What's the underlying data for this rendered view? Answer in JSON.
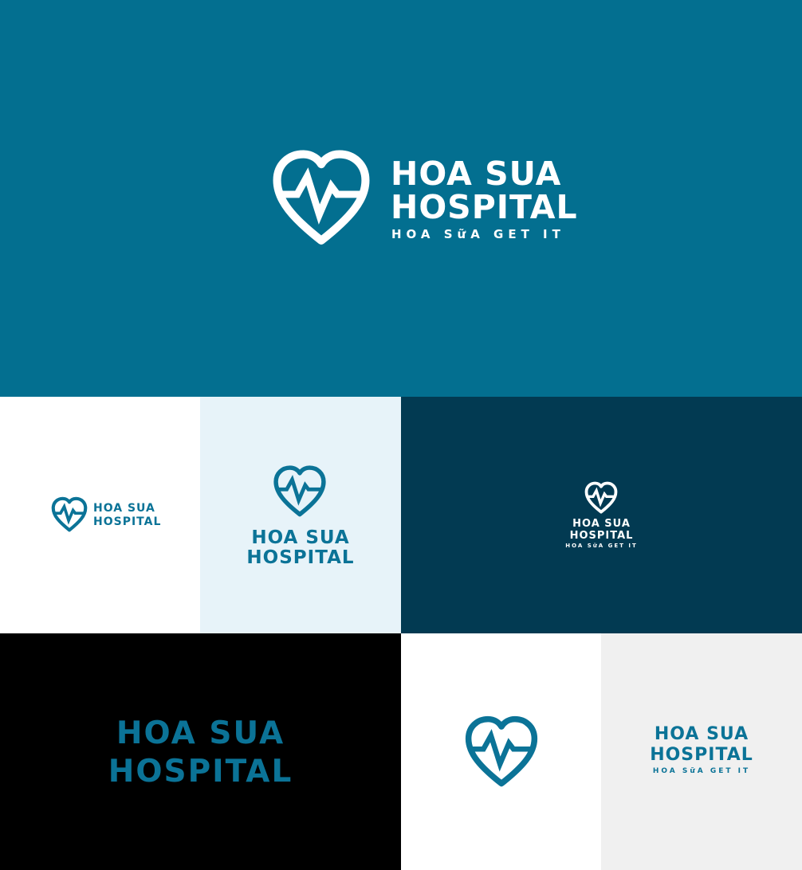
{
  "brand": {
    "line1": "HOA SUA",
    "line2": "HOSPITAL",
    "tagline": "HOA SữA GET IT"
  },
  "colors": {
    "primary": "#036f90",
    "light_panel": "#e7f3f9",
    "dark_panel": "#023a52",
    "black_panel": "#000000",
    "white_panel": "#ffffff",
    "gray_panel": "#f0f0f0",
    "logo_white": "#ffffff",
    "logo_blue": "#0b7397"
  },
  "icons": {
    "mark": "heart-pulse-icon"
  }
}
